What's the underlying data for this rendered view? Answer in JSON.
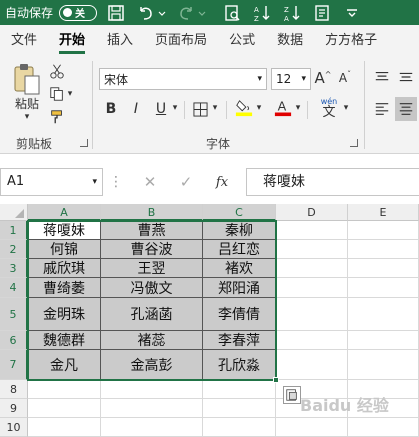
{
  "titlebar": {
    "autosave_label": "自动保存",
    "toggle_label": "关"
  },
  "tabs": [
    {
      "label": "文件",
      "active": false
    },
    {
      "label": "开始",
      "active": true
    },
    {
      "label": "插入",
      "active": false
    },
    {
      "label": "页面布局",
      "active": false
    },
    {
      "label": "公式",
      "active": false
    },
    {
      "label": "数据",
      "active": false
    },
    {
      "label": "方方格子",
      "active": false
    }
  ],
  "ribbon": {
    "paste_label": "粘贴",
    "clipboard_label": "剪贴板",
    "font_group_label": "字体",
    "font_name": "宋体",
    "font_size": "12",
    "bold": "B",
    "italic": "I",
    "underline": "U",
    "grow": "A",
    "shrink": "A",
    "wen": "wén",
    "wen_char": "文"
  },
  "formula_bar": {
    "name_box": "A1",
    "fx": "fx",
    "value": "蒋嗄妹"
  },
  "grid": {
    "columns": [
      "A",
      "B",
      "C",
      "D",
      "E"
    ],
    "rows": [
      "1",
      "2",
      "3",
      "4",
      "5",
      "6",
      "7",
      "8",
      "9",
      "10"
    ],
    "cells": [
      [
        "蒋嗄妹",
        "曹燕",
        "秦柳"
      ],
      [
        "何锦",
        "曹谷波",
        "吕红恋"
      ],
      [
        "戚欣琪",
        "王翌",
        "褚欢"
      ],
      [
        "曹绮萎",
        "冯傲文",
        "郑阳涌"
      ],
      [
        "金明珠",
        "孔涵菡",
        "李倩倩"
      ],
      [
        "魏德群",
        "褚蕊",
        "李春萍"
      ],
      [
        "金凡",
        "金高彭",
        "孔欣淼"
      ]
    ]
  },
  "watermark": "Baidu 经验",
  "colors": {
    "accent": "#217346",
    "fill": "#cbcbcb"
  }
}
